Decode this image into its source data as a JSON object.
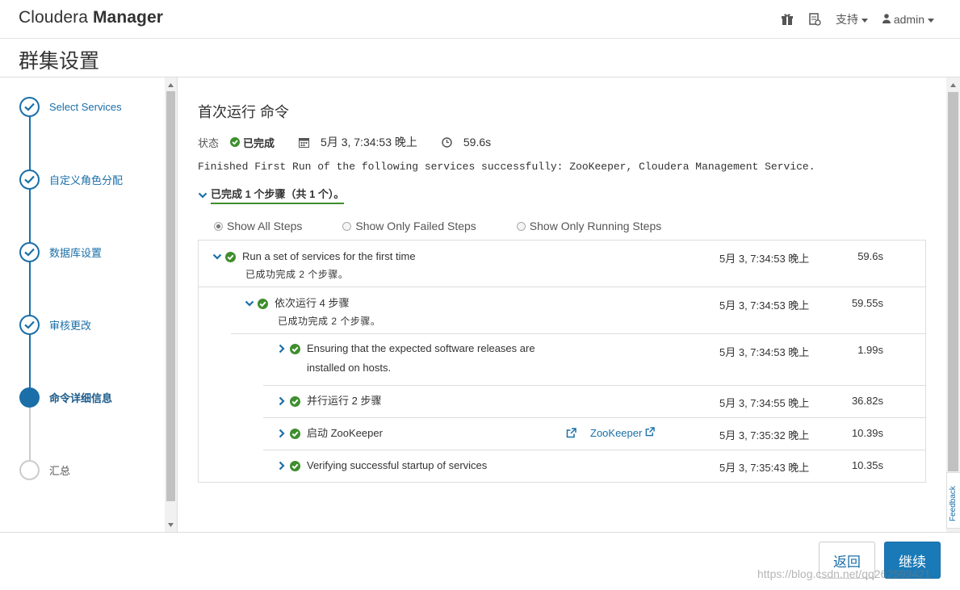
{
  "header": {
    "logo_prefix": "Cloudera ",
    "logo_bold": "Manager",
    "nav_icons": [
      "gift-icon",
      "notebook-icon"
    ],
    "support_label": "支持",
    "user_label": "admin"
  },
  "page_title": "群集设置",
  "wizard": {
    "steps": [
      {
        "label": "Select Services",
        "state": "done"
      },
      {
        "label": "自定义角色分配",
        "state": "done"
      },
      {
        "label": "数据库设置",
        "state": "done"
      },
      {
        "label": "审核更改",
        "state": "done"
      },
      {
        "label": "命令详细信息",
        "state": "active"
      },
      {
        "label": "汇总",
        "state": "todo"
      }
    ]
  },
  "command": {
    "title": "首次运行 命令",
    "status_label": "状态",
    "status_value": "已完成",
    "timestamp": "5月 3, 7:34:53 晚上",
    "duration": "59.6s",
    "message": "Finished First Run of the following services successfully: ZooKeeper, Cloudera Management Service.",
    "summary": "已完成 1 个步骤（共 1 个）。",
    "filters": [
      {
        "label": "Show All Steps",
        "selected": true
      },
      {
        "label": "Show Only Failed Steps",
        "selected": false
      },
      {
        "label": "Show Only Running Steps",
        "selected": false
      }
    ],
    "steps": [
      {
        "name": "Run a set of services for the first time",
        "sub": "已成功完成 2 个步骤。",
        "time": "5月 3, 7:34:53 晚上",
        "duration": "59.6s"
      },
      {
        "name": "依次运行 4 步骤",
        "sub": "已成功完成 2 个步骤。",
        "time": "5月 3, 7:34:53 晚上",
        "duration": "59.55s"
      },
      {
        "name": "Ensuring that the expected software releases are installed on hosts.",
        "time": "5月 3, 7:34:53 晚上",
        "duration": "1.99s"
      },
      {
        "name": "并行运行 2 步骤",
        "time": "5月 3, 7:34:55 晚上",
        "duration": "36.82s"
      },
      {
        "name": "启动 ZooKeeper",
        "link": "ZooKeeper",
        "time": "5月 3, 7:35:32 晚上",
        "duration": "10.39s"
      },
      {
        "name": "Verifying successful startup of services",
        "time": "5月 3, 7:35:43 晚上",
        "duration": "10.35s"
      }
    ]
  },
  "buttons": {
    "back": "返回",
    "next": "继续"
  },
  "feedback": "Feedback",
  "watermark": "https://blog.csdn.net/qq262593421",
  "colors": {
    "accent": "#1a6fa8",
    "success": "#3e8e2e"
  }
}
